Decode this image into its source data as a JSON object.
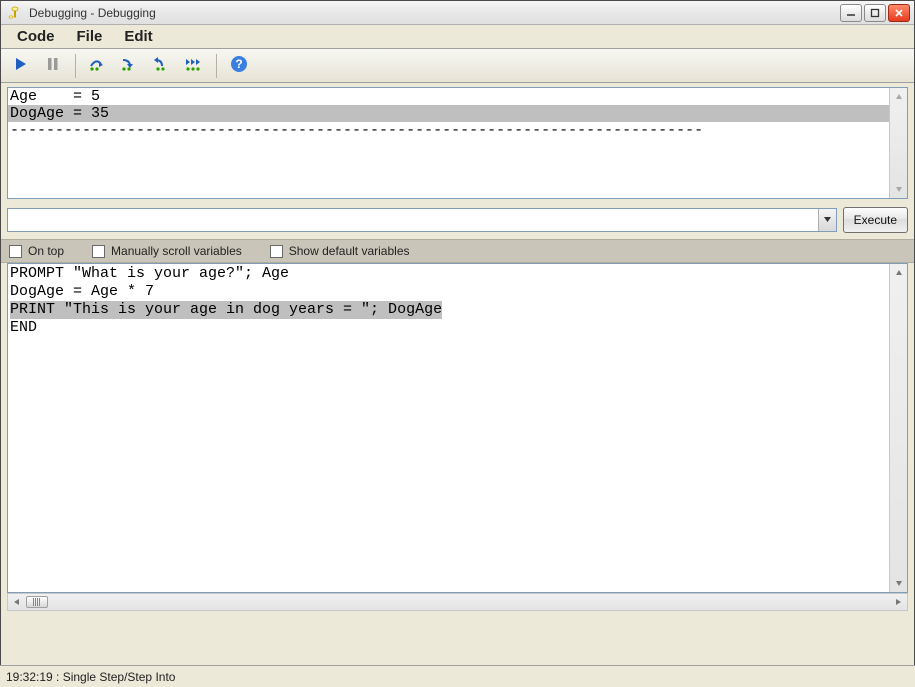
{
  "window": {
    "title": "Debugging - Debugging"
  },
  "menu": {
    "items": [
      "Code",
      "File",
      "Edit"
    ]
  },
  "toolbar": {
    "run": "run-icon",
    "pause": "pause-icon",
    "step_over": "step-over-icon",
    "step_into": "step-into-icon",
    "step_out": "step-out-icon",
    "run_to": "run-to-icon",
    "help": "help-icon"
  },
  "variables": {
    "lines": [
      {
        "text": "Age    = 5",
        "highlight": false
      },
      {
        "text": "DogAge = 35",
        "highlight": true
      },
      {
        "text": "-----------------------------------------------------------------------------",
        "highlight": false
      }
    ]
  },
  "command": {
    "value": "",
    "execute_label": "Execute"
  },
  "options": {
    "on_top": {
      "label": "On top",
      "checked": false
    },
    "manual_scroll": {
      "label": "Manually scroll variables",
      "checked": false
    },
    "show_defaults": {
      "label": "Show default variables",
      "checked": false
    }
  },
  "code": {
    "lines": [
      {
        "text": "PROMPT \"What is your age?\"; Age",
        "highlight": false
      },
      {
        "text": "DogAge = Age * 7",
        "highlight": false
      },
      {
        "text": "PRINT \"This is your age in dog years = \"; DogAge",
        "highlight": true
      },
      {
        "text": "END",
        "highlight": false
      }
    ]
  },
  "status": {
    "text": "19:32:19 : Single Step/Step Into"
  }
}
